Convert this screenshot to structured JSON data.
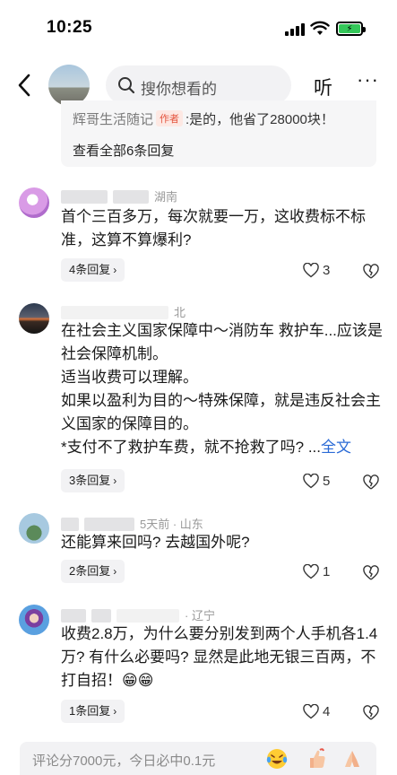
{
  "status": {
    "time": "10:25"
  },
  "nav": {
    "search_placeholder": "搜你想看的",
    "listen_label": "听",
    "more_label": "···"
  },
  "reply_preview": {
    "user": "辉哥生活随记",
    "author_tag": "作者",
    "text": ":是的，他省了28000块！",
    "view_all": "查看全部6条回复"
  },
  "comments": [
    {
      "meta": "湖南",
      "text": "首个三百多万，每次就要一万，这收费标不标准，这算不算爆利?",
      "reply_count": "4条回复",
      "likes": "3"
    },
    {
      "meta": "北",
      "text_lines": [
        "在社会主义国家保障中～消防车 救护车...应该是社会保障机制。",
        "适当收费可以理解。",
        "如果以盈利为目的～特殊保障，就是违反社会主义国家的保障目的。",
        "*支付不了救护车费，就不抢救了吗?"
      ],
      "ellipsis": "...",
      "fulltext": "全文",
      "reply_count": "3条回复",
      "likes": "5"
    },
    {
      "meta": "5天前 · 山东",
      "text": "还能算来回吗? 去越国外呢?",
      "reply_count": "2条回复",
      "likes": "1"
    },
    {
      "meta": "· 辽宁",
      "text": "收费2.8万，为什么要分别发到两个人手机各1.4万? 有什么必要吗? 显然是此地无银三百两，不打自招！😁😁",
      "reply_count": "1条回复",
      "likes": "4"
    }
  ],
  "bottom": {
    "placeholder": "评论分7000元，今日必中0.1元"
  },
  "icons": [
    "back-icon",
    "search-icon",
    "heart-icon",
    "broken-heart-icon",
    "laugh-cry-emoji",
    "thumbs-up-emoji",
    "pray-emoji"
  ],
  "colors": {
    "accent_link": "#2b6bd6",
    "author_tag": "#e4553f",
    "battery": "#34c759"
  }
}
